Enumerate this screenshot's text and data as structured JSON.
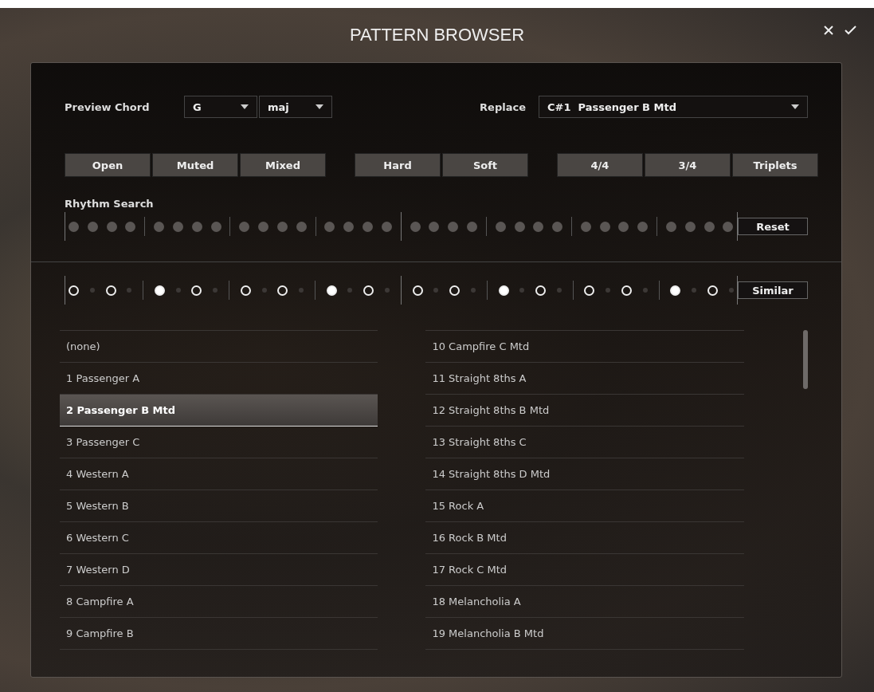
{
  "window": {
    "title": "PATTERN BROWSER"
  },
  "preview_chord": {
    "label": "Preview Chord",
    "root": "G",
    "quality": "maj"
  },
  "replace": {
    "label": "Replace",
    "value": "C#1  Passenger B Mtd"
  },
  "filter_groups": [
    [
      {
        "label": "Open",
        "selected": false
      },
      {
        "label": "Muted",
        "selected": false
      },
      {
        "label": "Mixed",
        "selected": false
      }
    ],
    [
      {
        "label": "Hard",
        "selected": false
      },
      {
        "label": "Soft",
        "selected": false
      }
    ],
    [
      {
        "label": "4/4",
        "selected": false
      },
      {
        "label": "3/4",
        "selected": false
      },
      {
        "label": "Triplets",
        "selected": false
      }
    ]
  ],
  "rhythm_search": {
    "label": "Rhythm Search",
    "reset": "Reset",
    "steps": [
      false,
      false,
      false,
      false,
      false,
      false,
      false,
      false,
      false,
      false,
      false,
      false,
      false,
      false,
      false,
      false,
      false,
      false,
      false,
      false,
      false,
      false,
      false,
      false,
      false,
      false,
      false,
      false,
      false,
      false,
      false,
      false
    ]
  },
  "similar": {
    "button": "Similar",
    "steps": [
      false,
      false,
      true,
      false,
      false,
      false,
      true,
      false,
      false,
      false,
      true,
      false,
      false,
      false,
      true,
      false
    ]
  },
  "patterns_left": [
    {
      "name": "(none)",
      "selected": false
    },
    {
      "name": "1 Passenger A",
      "selected": false
    },
    {
      "name": "2 Passenger B Mtd",
      "selected": true
    },
    {
      "name": "3 Passenger C",
      "selected": false
    },
    {
      "name": "4 Western A",
      "selected": false
    },
    {
      "name": "5 Western B",
      "selected": false
    },
    {
      "name": "6 Western C",
      "selected": false
    },
    {
      "name": "7 Western D",
      "selected": false
    },
    {
      "name": "8 Campfire A",
      "selected": false
    },
    {
      "name": "9 Campfire B",
      "selected": false
    }
  ],
  "patterns_right": [
    {
      "name": "10 Campfire C Mtd",
      "selected": false
    },
    {
      "name": "11 Straight 8ths A",
      "selected": false
    },
    {
      "name": "12 Straight 8ths B Mtd",
      "selected": false
    },
    {
      "name": "13 Straight 8ths C",
      "selected": false
    },
    {
      "name": "14 Straight 8ths D Mtd",
      "selected": false
    },
    {
      "name": "15 Rock A",
      "selected": false
    },
    {
      "name": "16 Rock B Mtd",
      "selected": false
    },
    {
      "name": "17 Rock C Mtd",
      "selected": false
    },
    {
      "name": "18 Melancholia A",
      "selected": false
    },
    {
      "name": "19 Melancholia B Mtd",
      "selected": false
    }
  ]
}
